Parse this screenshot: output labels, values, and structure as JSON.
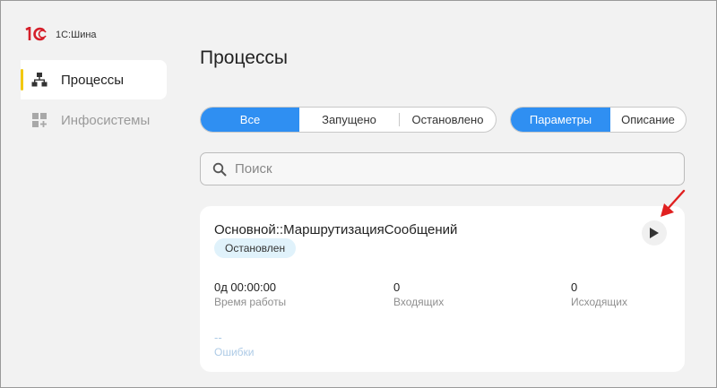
{
  "app": {
    "logo_text": "1С:Шина",
    "brand_color": "#d51e29"
  },
  "sidebar": {
    "items": [
      {
        "label": "Процессы",
        "icon": "process-tree-icon",
        "active": true
      },
      {
        "label": "Инфосистемы",
        "icon": "infosystems-icon",
        "active": false
      }
    ],
    "accent_color": "#f2c811"
  },
  "main": {
    "title": "Процессы",
    "status_filter": {
      "options": [
        "Все",
        "Запущено",
        "Остановлено"
      ],
      "selected": "Все"
    },
    "view_toggle": {
      "options": [
        "Параметры",
        "Описание"
      ],
      "selected": "Параметры"
    },
    "search": {
      "placeholder": "Поиск",
      "value": ""
    },
    "process_card": {
      "name": "Основной::МаршрутизацияСообщений",
      "status": "Остановлен",
      "action_icon": "play-icon",
      "stats": [
        {
          "value": "0д 00:00:00",
          "label": "Время работы"
        },
        {
          "value": "0",
          "label": "Входящих"
        },
        {
          "value": "0",
          "label": "Исходящих"
        }
      ],
      "errors": {
        "value": "--",
        "label": "Ошибки"
      }
    }
  },
  "colors": {
    "selected": "#2f8ff2",
    "annotation_arrow": "#e02020"
  }
}
